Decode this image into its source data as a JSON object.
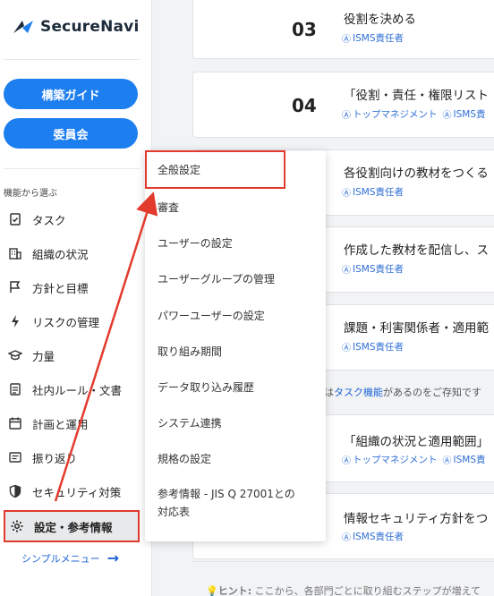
{
  "brand": {
    "name": "SecureNavi"
  },
  "sidebar": {
    "guide_button": "構築ガイド",
    "committee_button": "委員会",
    "section_label": "機能から選ぶ",
    "items": [
      {
        "label": "タスク",
        "icon": "task-check-icon"
      },
      {
        "label": "組織の状況",
        "icon": "building-icon"
      },
      {
        "label": "方針と目標",
        "icon": "flag-icon"
      },
      {
        "label": "リスクの管理",
        "icon": "lightning-icon"
      },
      {
        "label": "力量",
        "icon": "graduation-cap-icon"
      },
      {
        "label": "社内ルール・文書",
        "icon": "document-icon"
      },
      {
        "label": "計画と運用",
        "icon": "calendar-icon"
      },
      {
        "label": "振り返り",
        "icon": "review-doc-icon"
      },
      {
        "label": "セキュリティ対策",
        "icon": "shield-icon"
      },
      {
        "label": "設定・参考情報",
        "icon": "gear-icon"
      }
    ],
    "simple_menu_link": "シンプルメニュー"
  },
  "menu": {
    "items": [
      "全般設定",
      "審査",
      "ユーザーの設定",
      "ユーザーグループの管理",
      "パワーユーザーの設定",
      "取り組み期間",
      "データ取り込み履歴",
      "システム連携",
      "規格の設定",
      "参考情報 - JIS Q 27001との",
      "対応表"
    ]
  },
  "cards": [
    {
      "num": "03",
      "title": "役割を決める",
      "tags": [
        "ISMS責任者"
      ]
    },
    {
      "num": "04",
      "title": "「役割・責任・権限リスト",
      "tags": [
        "トップマネジメント",
        "ISMS責"
      ]
    },
    {
      "num": "",
      "title": "各役割向けの教材をつくる",
      "tags": [
        "ISMS責任者"
      ]
    },
    {
      "num": "",
      "title": "作成した教材を配信し、ス",
      "tags": [
        "ISMS責任者"
      ]
    },
    {
      "num": "",
      "title": "課題・利害関係者・適用範",
      "tags": [
        "ISMS責任者"
      ]
    },
    {
      "num": "",
      "title": "「組織の状況と適用範囲」",
      "tags": [
        "トップマネジメント",
        "ISMS責"
      ]
    },
    {
      "num": "",
      "title": "情報セキュリティ方針をつ",
      "tags": [
        "ISMS責任者"
      ]
    }
  ],
  "hint": {
    "prefix": "は",
    "link": "タスク機能",
    "suffix": "があるのをご存知です",
    "bottom_label": "ヒント:",
    "bottom_text": " ここから、各部門ごとに取り組むステップが増えて"
  }
}
